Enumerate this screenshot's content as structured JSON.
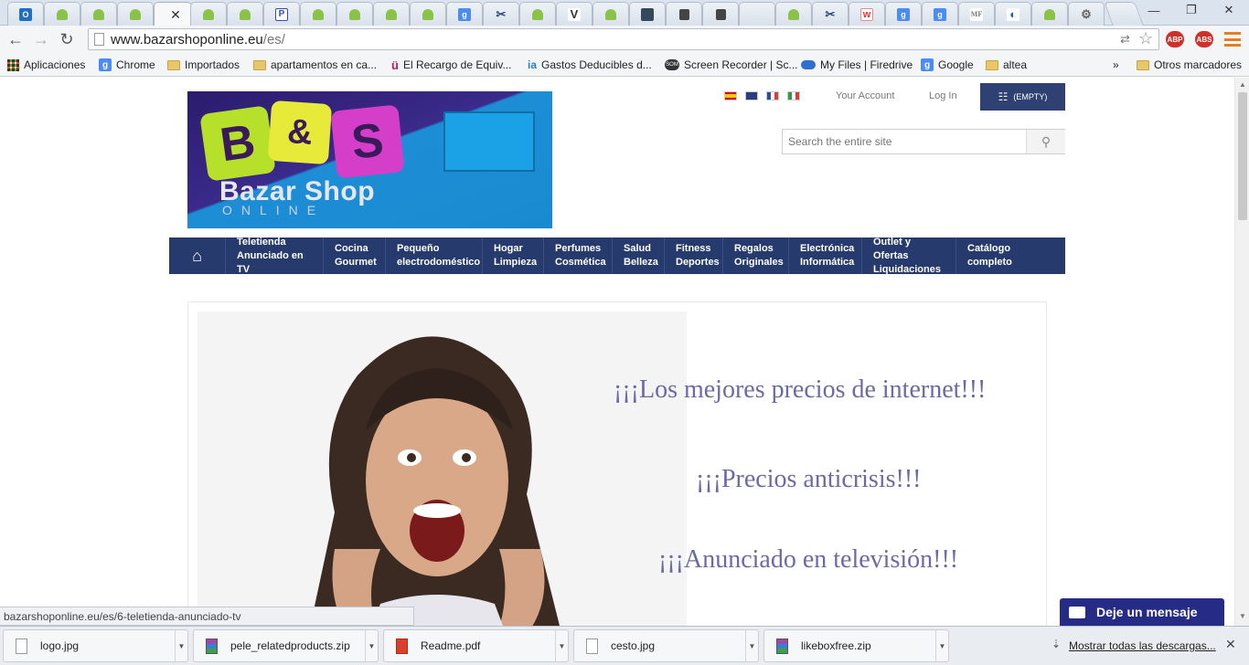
{
  "browser": {
    "tabs": [
      {
        "icon": "outlook-icon",
        "glyph": "O",
        "class": "fav-outlook"
      },
      {
        "icon": "android-icon",
        "glyph": "",
        "class": "fav-android"
      },
      {
        "icon": "android-icon",
        "glyph": "",
        "class": "fav-android"
      },
      {
        "icon": "android-icon",
        "glyph": "",
        "class": "fav-android"
      },
      {
        "icon": "close-icon",
        "glyph": "",
        "class": "",
        "active": true
      },
      {
        "icon": "android-icon",
        "glyph": "",
        "class": "fav-android"
      },
      {
        "icon": "android-icon",
        "glyph": "",
        "class": "fav-android"
      },
      {
        "icon": "p-logo-icon",
        "glyph": "P",
        "class": "fav-p"
      },
      {
        "icon": "android-icon",
        "glyph": "",
        "class": "fav-android"
      },
      {
        "icon": "android-icon",
        "glyph": "",
        "class": "fav-android"
      },
      {
        "icon": "android-icon",
        "glyph": "",
        "class": "fav-android"
      },
      {
        "icon": "android-icon",
        "glyph": "",
        "class": "fav-android"
      },
      {
        "icon": "google-icon",
        "glyph": "g",
        "class": "fav-g"
      },
      {
        "icon": "scissors-icon",
        "glyph": "✂",
        "class": "fav-x"
      },
      {
        "icon": "android-icon",
        "glyph": "",
        "class": "fav-android"
      },
      {
        "icon": "v-logo-icon",
        "glyph": "V",
        "class": "fav-v"
      },
      {
        "icon": "android-icon",
        "glyph": "",
        "class": "fav-android"
      },
      {
        "icon": "news-icon",
        "glyph": "",
        "class": "fav-news"
      },
      {
        "icon": "lock-icon",
        "glyph": "",
        "class": "fav-lock"
      },
      {
        "icon": "lock-icon",
        "glyph": "",
        "class": "fav-lock"
      },
      {
        "icon": "blank-icon",
        "glyph": "",
        "class": ""
      },
      {
        "icon": "android-icon",
        "glyph": "",
        "class": "fav-android"
      },
      {
        "icon": "scissors-icon",
        "glyph": "✂",
        "class": "fav-x"
      },
      {
        "icon": "w-logo-icon",
        "glyph": "w",
        "class": "fav-w"
      },
      {
        "icon": "google-icon",
        "glyph": "g",
        "class": "fav-g"
      },
      {
        "icon": "google-icon",
        "glyph": "g",
        "class": "fav-g"
      },
      {
        "icon": "mf-logo-icon",
        "glyph": "MF",
        "class": "fav-mf"
      },
      {
        "icon": "ring-icon",
        "glyph": "◐",
        "class": "fav-ring"
      },
      {
        "icon": "android-icon",
        "glyph": "",
        "class": "fav-android"
      },
      {
        "icon": "gear-icon",
        "glyph": "⚙",
        "class": "fav-gear"
      }
    ],
    "url_host": "www.bazarshoponline.eu",
    "url_path": "/es/",
    "extensions": [
      {
        "name": "adblock-plus-icon",
        "label": "ABP",
        "color": "#d0302a"
      },
      {
        "name": "adblock-icon",
        "label": "ABS",
        "color": "#d0302a"
      }
    ],
    "bookmarks": [
      {
        "label": "Aplicaciones",
        "icon": "apps-grid-icon"
      },
      {
        "label": "Chrome",
        "icon": "google-icon"
      },
      {
        "label": "Importados",
        "icon": "folder-icon"
      },
      {
        "label": "apartamentos en ca...",
        "icon": "folder-icon"
      },
      {
        "label": "El Recargo de Equiv...",
        "icon": "u-logo-icon"
      },
      {
        "label": "Gastos Deducibles d...",
        "icon": "ia-logo-icon"
      },
      {
        "label": "Screen Recorder | Sc...",
        "icon": "som-logo-icon"
      },
      {
        "label": "My Files | Firedrive",
        "icon": "cloud-icon"
      },
      {
        "label": "Google",
        "icon": "google-icon"
      },
      {
        "label": "altea",
        "icon": "folder-icon"
      }
    ],
    "bookmarks_more": "»",
    "other_bookmarks": "Otros marcadores"
  },
  "header": {
    "your_account": "Your Account",
    "log_in": "Log In",
    "cart_label": "(EMPTY)",
    "search_placeholder": "Search the entire site",
    "logo": {
      "b": "B",
      "amp": "&",
      "s": "S",
      "name": "Bazar Shop",
      "sub": "ONLINE"
    }
  },
  "menu": [
    {
      "l1": "Teletienda",
      "l2": "Anunciado en TV"
    },
    {
      "l1": "Cocina",
      "l2": "Gourmet"
    },
    {
      "l1": "Pequeño",
      "l2": "electrodoméstico"
    },
    {
      "l1": "Hogar",
      "l2": "Limpieza"
    },
    {
      "l1": "Perfumes",
      "l2": "Cosmética"
    },
    {
      "l1": "Salud",
      "l2": "Belleza"
    },
    {
      "l1": "Fitness",
      "l2": "Deportes"
    },
    {
      "l1": "Regalos",
      "l2": "Originales"
    },
    {
      "l1": "Electrónica",
      "l2": "Informática"
    },
    {
      "l1": "Outlet y Ofertas",
      "l2": "Liquidaciones"
    },
    {
      "l1": "Catálogo",
      "l2": "completo"
    }
  ],
  "banner": {
    "line1": "¡¡¡Los mejores precios de internet!!!",
    "line2": "¡¡¡Precios anticrisis!!!",
    "line3": "¡¡¡Anunciado en televisión!!!"
  },
  "status_url": "bazarshoponline.eu/es/6-teletienda-anunciado-tv",
  "chat_label": "Deje un mensaje",
  "downloads": [
    {
      "name": "logo.jpg",
      "type": "jpg"
    },
    {
      "name": "pele_relatedproducts.zip",
      "type": "zip"
    },
    {
      "name": "Readme.pdf",
      "type": "pdf"
    },
    {
      "name": "cesto.jpg",
      "type": "jpg"
    },
    {
      "name": "likeboxfree.zip",
      "type": "zip"
    }
  ],
  "show_all_downloads": "Mostrar todas las descargas...",
  "colors": {
    "nav_blue": "#263a6e",
    "cart_blue": "#2f4173",
    "banner_text": "#6b6aa8",
    "chat_blue": "#262b86"
  }
}
